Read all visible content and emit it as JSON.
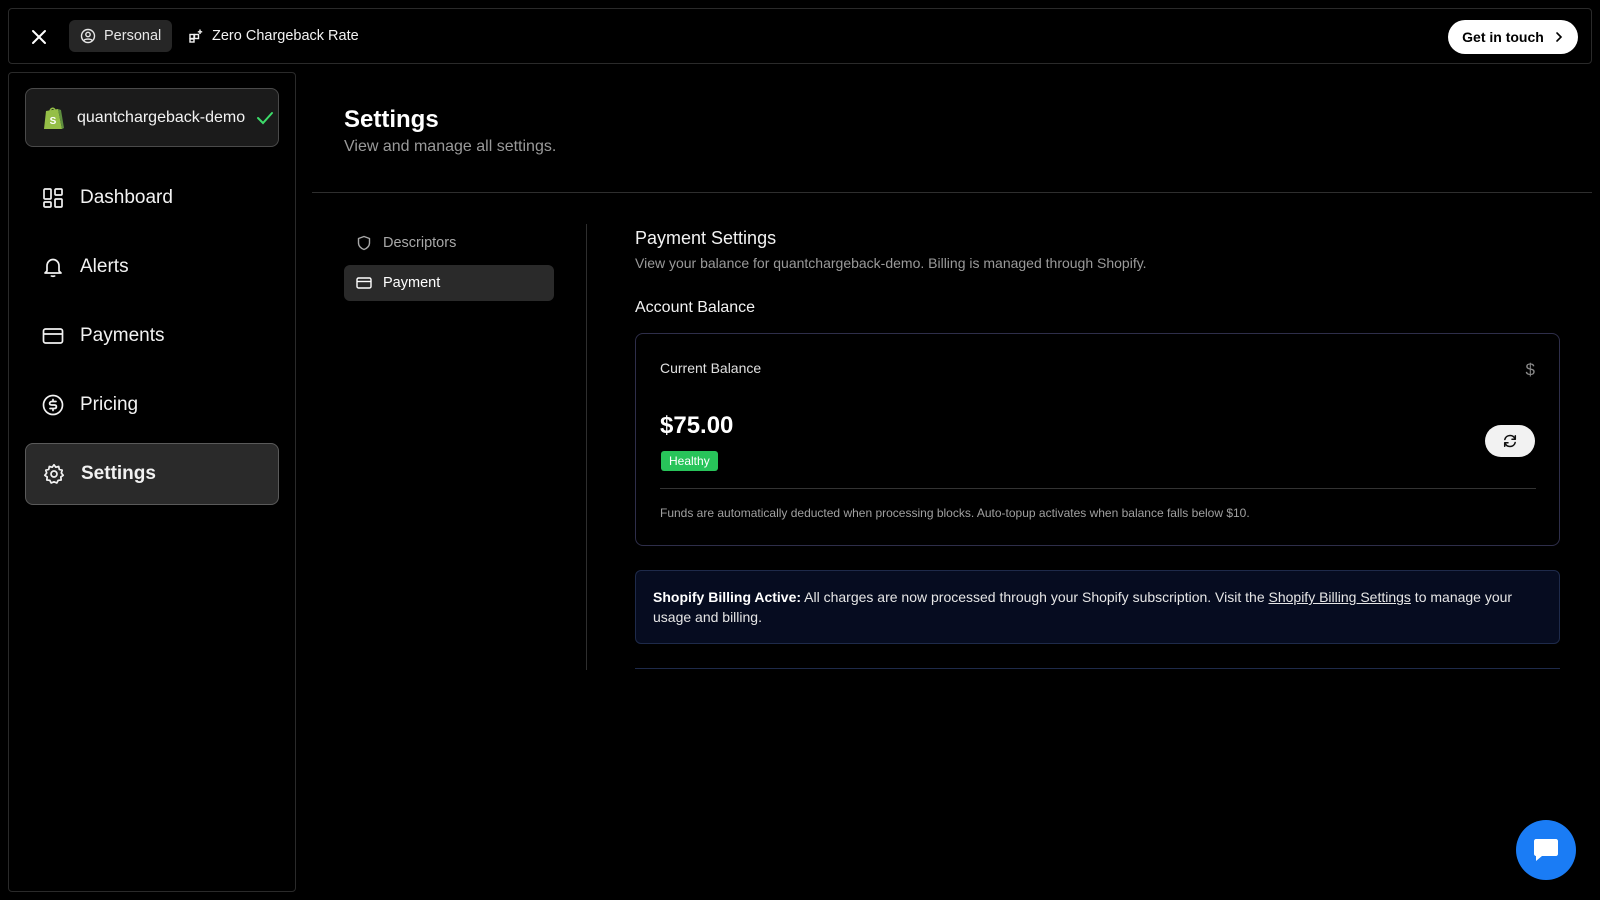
{
  "topbar": {
    "close_icon": "close-icon",
    "tabs": [
      {
        "label": "Personal",
        "icon": "user-circle-icon"
      },
      {
        "label": "Zero Chargeback Rate",
        "icon": "apps-add-icon"
      }
    ],
    "cta_label": "Get in touch"
  },
  "sidebar": {
    "store_name": "quantchargeback-demo",
    "items": [
      {
        "label": "Dashboard",
        "icon": "dashboard-icon"
      },
      {
        "label": "Alerts",
        "icon": "bell-icon"
      },
      {
        "label": "Payments",
        "icon": "credit-card-icon"
      },
      {
        "label": "Pricing",
        "icon": "dollar-circle-icon"
      },
      {
        "label": "Settings",
        "icon": "gear-icon",
        "active": true
      }
    ]
  },
  "page": {
    "title": "Settings",
    "subtitle": "View and manage all settings."
  },
  "subnav": {
    "items": [
      {
        "label": "Descriptors",
        "icon": "shield-icon"
      },
      {
        "label": "Payment",
        "icon": "credit-card-icon",
        "active": true
      }
    ]
  },
  "payment": {
    "title": "Payment Settings",
    "subtitle": "View your balance for quantchargeback-demo. Billing is managed through Shopify.",
    "account_balance_title": "Account Balance",
    "card": {
      "label": "Current Balance",
      "currency_symbol": "$",
      "balance": "$75.00",
      "status": "Healthy",
      "note": "Funds are automatically deducted when processing blocks. Auto-topup activates when balance falls below $10."
    },
    "alert": {
      "bold": "Shopify Billing Active:",
      "text_before": " All charges are now processed through your Shopify subscription. Visit the ",
      "link": "Shopify Billing Settings",
      "text_after": " to manage your usage and billing."
    }
  },
  "colors": {
    "background": "#000000",
    "status_healthy": "#28c45a",
    "chat_button": "#1a7cf5",
    "check": "#3ddc6a"
  }
}
